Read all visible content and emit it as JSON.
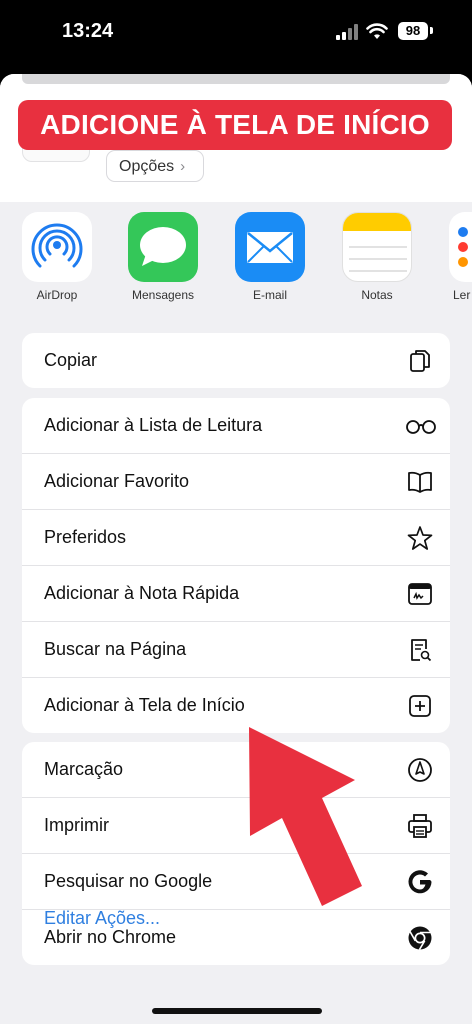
{
  "status": {
    "time": "13:24",
    "battery": "98"
  },
  "header": {
    "banner_text": "ADICIONE À TELA DE INÍCIO",
    "options_label": "Opções",
    "options_chevron": "›"
  },
  "apps": [
    {
      "label": "AirDrop",
      "icon": "airdrop-icon"
    },
    {
      "label": "Mensagens",
      "icon": "messages-icon"
    },
    {
      "label": "E-mail",
      "icon": "mail-icon"
    },
    {
      "label": "Notas",
      "icon": "notes-icon"
    },
    {
      "label": "Ler",
      "icon": "reminders-icon"
    }
  ],
  "groups": [
    {
      "items": [
        {
          "label": "Copiar",
          "icon": "copy-icon"
        }
      ]
    },
    {
      "items": [
        {
          "label": "Adicionar à Lista de Leitura",
          "icon": "glasses-icon"
        },
        {
          "label": "Adicionar Favorito",
          "icon": "book-icon"
        },
        {
          "label": "Preferidos",
          "icon": "star-icon"
        },
        {
          "label": "Adicionar à Nota Rápida",
          "icon": "quick-note-icon"
        },
        {
          "label": "Buscar na Página",
          "icon": "find-in-page-icon"
        },
        {
          "label": "Adicionar à Tela de Início",
          "icon": "add-square-icon"
        }
      ]
    },
    {
      "items": [
        {
          "label": "Marcação",
          "icon": "markup-icon"
        },
        {
          "label": "Imprimir",
          "icon": "printer-icon"
        },
        {
          "label": "Pesquisar no Google",
          "icon": "google-icon"
        },
        {
          "label": "Abrir no Chrome",
          "icon": "chrome-icon"
        }
      ]
    }
  ],
  "footer": {
    "edit_actions": "Editar Ações..."
  },
  "colors": {
    "banner": "#e8303f",
    "arrow": "#e8303f",
    "link": "#2f7fe0",
    "airdrop": "#1e7cf0",
    "messages": "#34c759",
    "mail": "#1a8cf5",
    "notes": "#ffcc00"
  }
}
